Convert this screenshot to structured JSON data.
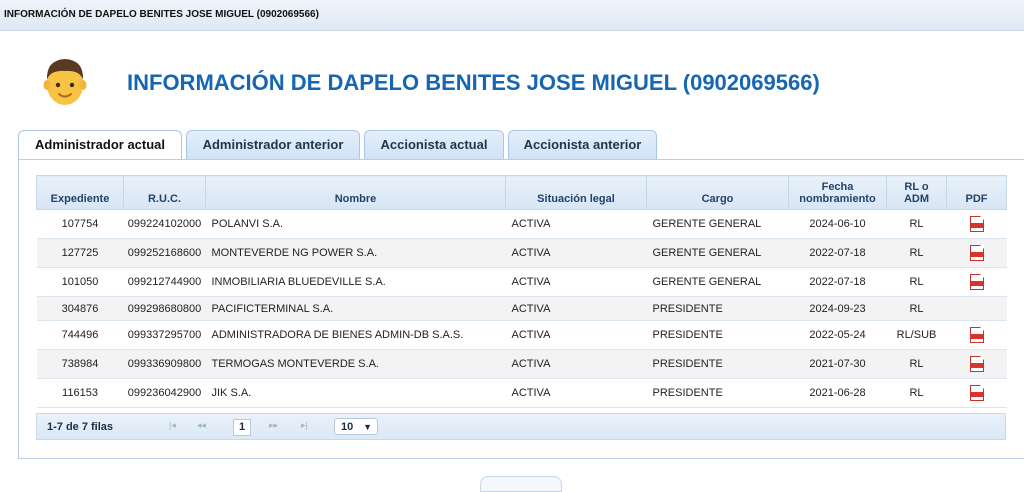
{
  "window": {
    "title": "INFORMACIÓN DE DAPELO BENITES JOSE MIGUEL (0902069566)"
  },
  "header": {
    "title": "INFORMACIÓN DE DAPELO BENITES JOSE MIGUEL (0902069566)",
    "avatar_icon": "man-face-icon"
  },
  "tabs": [
    {
      "label": "Administrador actual",
      "active": true
    },
    {
      "label": "Administrador anterior",
      "active": false
    },
    {
      "label": "Accionista actual",
      "active": false
    },
    {
      "label": "Accionista anterior",
      "active": false
    }
  ],
  "table": {
    "columns": [
      "Expediente",
      "R.U.C.",
      "Nombre",
      "Situación legal",
      "Cargo",
      "Fecha nombramiento",
      "RL o ADM",
      "PDF"
    ],
    "rows": [
      {
        "expediente": "107754",
        "ruc": "099224102000",
        "nombre": "POLANVI S.A.",
        "situacion": "ACTIVA",
        "cargo": "GERENTE GENERAL",
        "fecha": "2024-06-10",
        "rl": "RL",
        "pdf": "pdf-icon"
      },
      {
        "expediente": "127725",
        "ruc": "099252168600",
        "nombre": "MONTEVERDE NG POWER S.A.",
        "situacion": "ACTIVA",
        "cargo": "GERENTE GENERAL",
        "fecha": "2022-07-18",
        "rl": "RL",
        "pdf": "pdf-icon"
      },
      {
        "expediente": "101050",
        "ruc": "099212744900",
        "nombre": "INMOBILIARIA BLUEDEVILLE S.A.",
        "situacion": "ACTIVA",
        "cargo": "GERENTE GENERAL",
        "fecha": "2022-07-18",
        "rl": "RL",
        "pdf": "pdf-icon"
      },
      {
        "expediente": "304876",
        "ruc": "099298680800",
        "nombre": "PACIFICTERMINAL S.A.",
        "situacion": "ACTIVA",
        "cargo": "PRESIDENTE",
        "fecha": "2024-09-23",
        "rl": "RL",
        "pdf": ""
      },
      {
        "expediente": "744496",
        "ruc": "099337295700",
        "nombre": "ADMINISTRADORA DE BIENES ADMIN-DB S.A.S.",
        "situacion": "ACTIVA",
        "cargo": "PRESIDENTE",
        "fecha": "2022-05-24",
        "rl": "RL/SUB",
        "pdf": "pdf-icon"
      },
      {
        "expediente": "738984",
        "ruc": "099336909800",
        "nombre": "TERMOGAS MONTEVERDE S.A.",
        "situacion": "ACTIVA",
        "cargo": "PRESIDENTE",
        "fecha": "2021-07-30",
        "rl": "RL",
        "pdf": "pdf-icon"
      },
      {
        "expediente": "116153",
        "ruc": "099236042900",
        "nombre": "JIK S.A.",
        "situacion": "ACTIVA",
        "cargo": "PRESIDENTE",
        "fecha": "2021-06-28",
        "rl": "RL",
        "pdf": "pdf-icon"
      }
    ]
  },
  "pager": {
    "info": "1-7 de 7 filas",
    "first_icon": "first-page-icon",
    "prev_icon": "previous-page-icon",
    "current_page": "1",
    "next_icon": "next-page-icon",
    "last_icon": "last-page-icon",
    "page_size": "10",
    "page_size_chevron": "chevron-down-icon"
  },
  "colors": {
    "accent": "#1766b3",
    "pdf": "#d9342b"
  }
}
